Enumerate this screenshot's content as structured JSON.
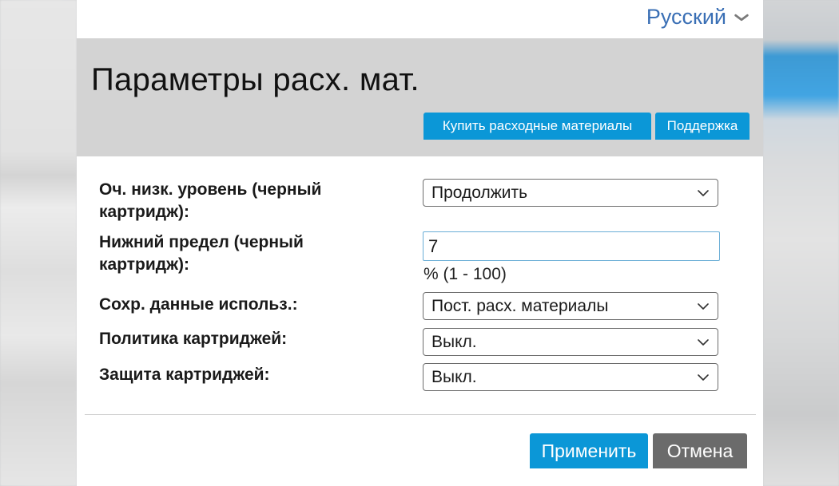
{
  "language": {
    "selected": "Русский",
    "icon": "chevron-down-icon"
  },
  "header": {
    "title": "Параметры расх. мат.",
    "buttons": {
      "buy_supplies": "Купить расходные материалы",
      "support": "Поддержка"
    }
  },
  "form": {
    "very_low_black": {
      "label": "Оч. низк. уровень (черный картридж):",
      "value": "Продолжить"
    },
    "low_threshold_black": {
      "label": "Нижний предел (черный картридж):",
      "value": "7",
      "hint": "% (1 - 100)"
    },
    "store_usage_data": {
      "label": "Сохр. данные использ.:",
      "value": "Пост. расх. материалы"
    },
    "cartridge_policy": {
      "label": "Политика картриджей:",
      "value": "Выкл."
    },
    "cartridge_protection": {
      "label": "Защита картриджей:",
      "value": "Выкл."
    }
  },
  "footer": {
    "apply": "Применить",
    "cancel": "Отмена"
  },
  "colors": {
    "accent_blue": "#0b97d7",
    "header_gray": "#d3d3d3",
    "cancel_gray": "#6b6b6b",
    "language_link": "#3a6fb5"
  }
}
